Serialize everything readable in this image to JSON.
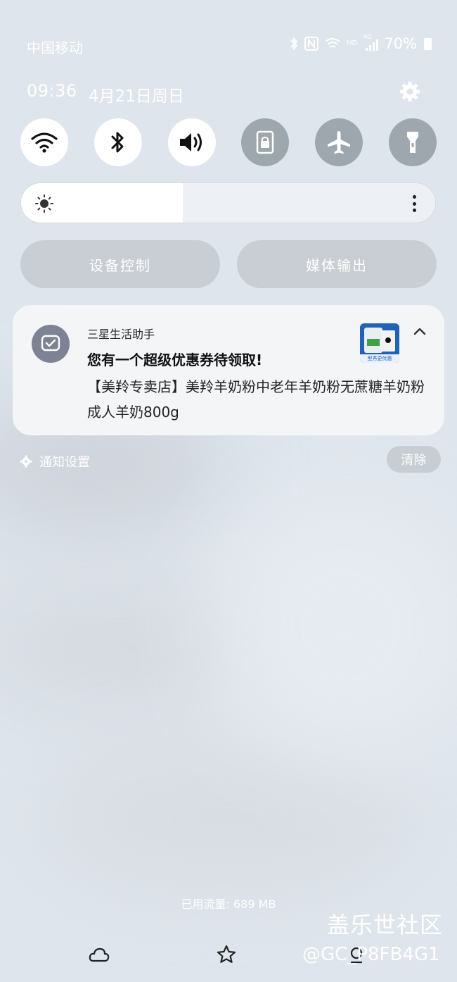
{
  "status_bar": {
    "carrier": "中国移动",
    "hd_label": "HD",
    "network_label": "4G",
    "battery": "70%"
  },
  "header": {
    "time": "09:36",
    "date": "4月21日周日"
  },
  "quick_settings": [
    {
      "name": "wifi",
      "state": "on"
    },
    {
      "name": "bluetooth",
      "state": "on"
    },
    {
      "name": "sound",
      "state": "on"
    },
    {
      "name": "rotation-lock",
      "state": "off"
    },
    {
      "name": "airplane-mode",
      "state": "off"
    },
    {
      "name": "flashlight",
      "state": "off"
    }
  ],
  "brightness": {
    "level": 0.39
  },
  "controls": {
    "device_control": "设备控制",
    "media_output": "媒体输出"
  },
  "notification": {
    "app_name": "三星生活助手",
    "title": "您有一个超级优惠券待领取!",
    "body": "【美羚专卖店】美羚羊奶粉中老年羊奶粉无蔗糖羊奶粉成人羊奶800g",
    "thumb_caption": "型秀更优惠"
  },
  "notification_footer": {
    "settings_label": "通知设置",
    "clear_label": "清除"
  },
  "data_usage": "已用流量: 689 MB",
  "watermark": {
    "name": "盖乐世社区",
    "id": "@GC_P8FB4G1"
  },
  "colors": {
    "background": "#dfe5ec",
    "tile_on": "#ffffff",
    "tile_off": "#9ea6ae",
    "card": "#f3f5f7"
  }
}
